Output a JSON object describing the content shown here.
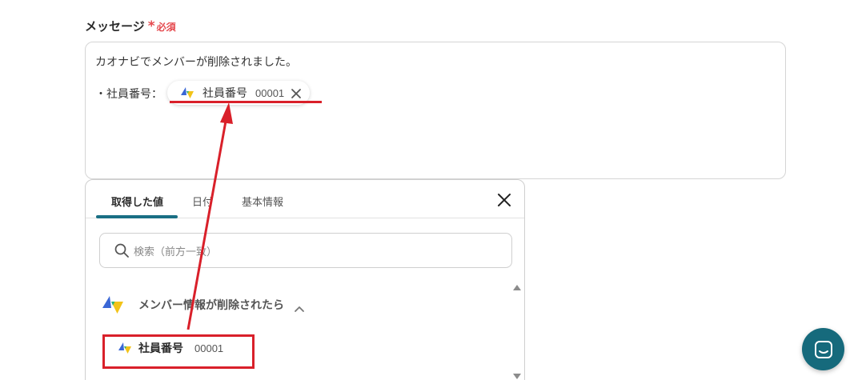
{
  "field": {
    "label": "メッセージ",
    "asterisk": "*",
    "required": "必須"
  },
  "message": {
    "line1": "カオナビでメンバーが削除されました。",
    "line2_prefix": "・社員番号："
  },
  "chip": {
    "icon": "kaonavi-app-icon",
    "name": "社員番号",
    "value": "00001"
  },
  "panel": {
    "tabs": [
      {
        "label": "取得した値",
        "active": true
      },
      {
        "label": "日付",
        "active": false
      },
      {
        "label": "基本情報",
        "active": false
      }
    ],
    "search": {
      "placeholder": "検索（前方一致）"
    },
    "group": {
      "label": "メンバー情報が削除されたら",
      "expanded": true
    },
    "items": [
      {
        "name": "社員番号",
        "value": "00001"
      }
    ]
  },
  "colors": {
    "accent": "#1a6f84",
    "annotation_red": "#d9202a",
    "required_red": "#e5484d",
    "chat_button": "#166a7c"
  }
}
